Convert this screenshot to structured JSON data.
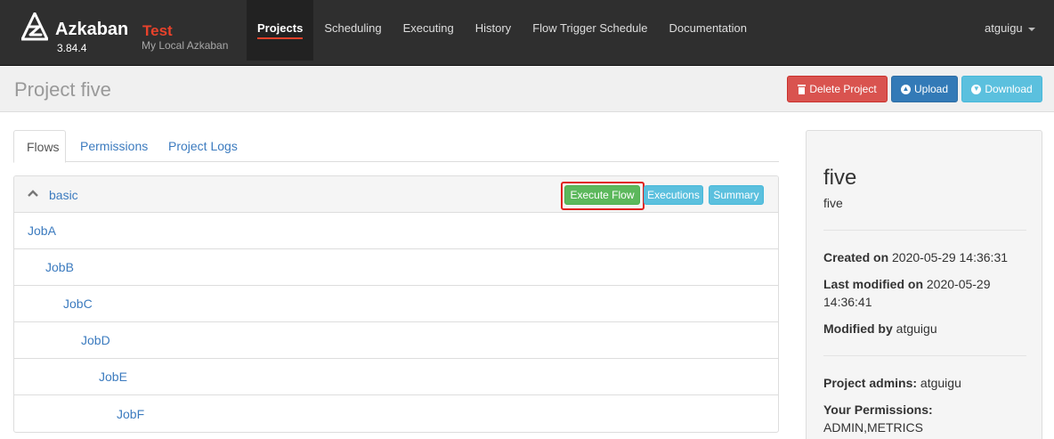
{
  "navbar": {
    "brand": "Azkaban",
    "env": "Test",
    "version": "3.84.4",
    "subtitle": "My Local Azkaban",
    "items": [
      {
        "label": "Projects",
        "active": true
      },
      {
        "label": "Scheduling",
        "active": false
      },
      {
        "label": "Executing",
        "active": false
      },
      {
        "label": "History",
        "active": false
      },
      {
        "label": "Flow Trigger Schedule",
        "active": false
      },
      {
        "label": "Documentation",
        "active": false
      }
    ],
    "user": "atguigu"
  },
  "header": {
    "title": "Project five",
    "delete_label": "Delete Project",
    "upload_label": "Upload",
    "download_label": "Download"
  },
  "tabs": {
    "flows": "Flows",
    "permissions": "Permissions",
    "project_logs": "Project Logs"
  },
  "flow": {
    "name": "basic",
    "execute_label": "Execute Flow",
    "executions_label": "Executions",
    "summary_label": "Summary",
    "jobs": [
      "JobA",
      "JobB",
      "JobC",
      "JobD",
      "JobE",
      "JobF"
    ]
  },
  "sidebar": {
    "project_name": "five",
    "description": "five",
    "created_label": "Created on",
    "created_value": "2020-05-29 14:36:31",
    "modified_label": "Last modified on",
    "modified_value_1": "2020-05-29",
    "modified_value_2": "14:36:41",
    "modified_by_label": "Modified by",
    "modified_by_value": "atguigu",
    "admins_label": "Project admins:",
    "admins_value": "atguigu",
    "permissions_label": "Your Permissions:",
    "permissions_value": "ADMIN,METRICS"
  },
  "colors": {
    "navbar": "#2f2f2f",
    "accent": "#e8422b",
    "link": "#3c7bbf",
    "danger": "#d9534f",
    "primary": "#337ab7",
    "info": "#5bc0de",
    "success": "#5cb85c"
  }
}
